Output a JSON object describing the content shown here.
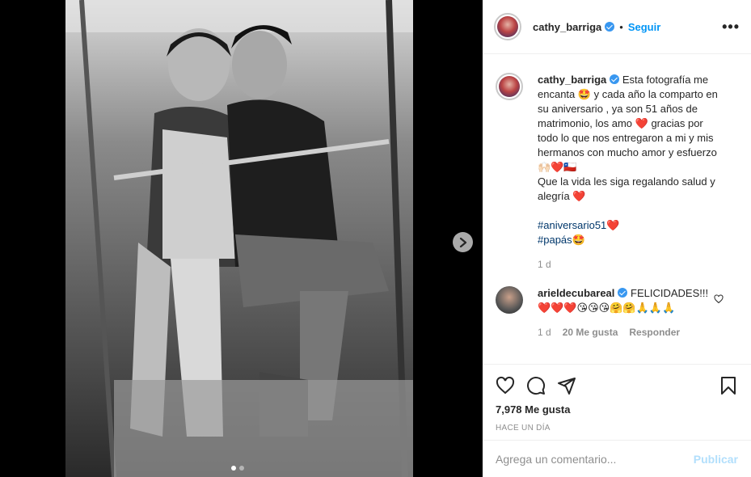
{
  "post": {
    "username": "cathy_barriga",
    "follow_label": "Seguir",
    "more_label": "•••"
  },
  "caption": {
    "username": "cathy_barriga",
    "line1": "Esta fotografía me encanta 🤩 y cada año la comparto en su aniversario , ya son 51 años de matrimonio, los amo ❤️ gracias por todo lo que nos entregaron a mi y mis hermanos con mucho amor y esfuerzo 🙌🏻❤️🇨🇱",
    "line2": "Que la vida les siga regalando salud y alegría ❤️",
    "hashtag1": "#aniversario51❤️",
    "hashtag2": "#papás🤩",
    "time": "1 d"
  },
  "comment1": {
    "username": "arieldecubareal",
    "text": "FELICIDADES!!! ❤️❤️❤️😘😘😘🤗🤗🙏🙏🙏",
    "time": "1 d",
    "likes": "20 Me gusta",
    "reply": "Responder"
  },
  "likes_text": "7,978 Me gusta",
  "time_ago": "HACE UN DÍA",
  "comment_bar": {
    "placeholder": "Agrega un comentario...",
    "publish": "Publicar"
  },
  "colors": {
    "accent": "#0095f6",
    "verified": "#3897f0",
    "hashtag": "#00376b",
    "muted": "#8e8e8e"
  }
}
